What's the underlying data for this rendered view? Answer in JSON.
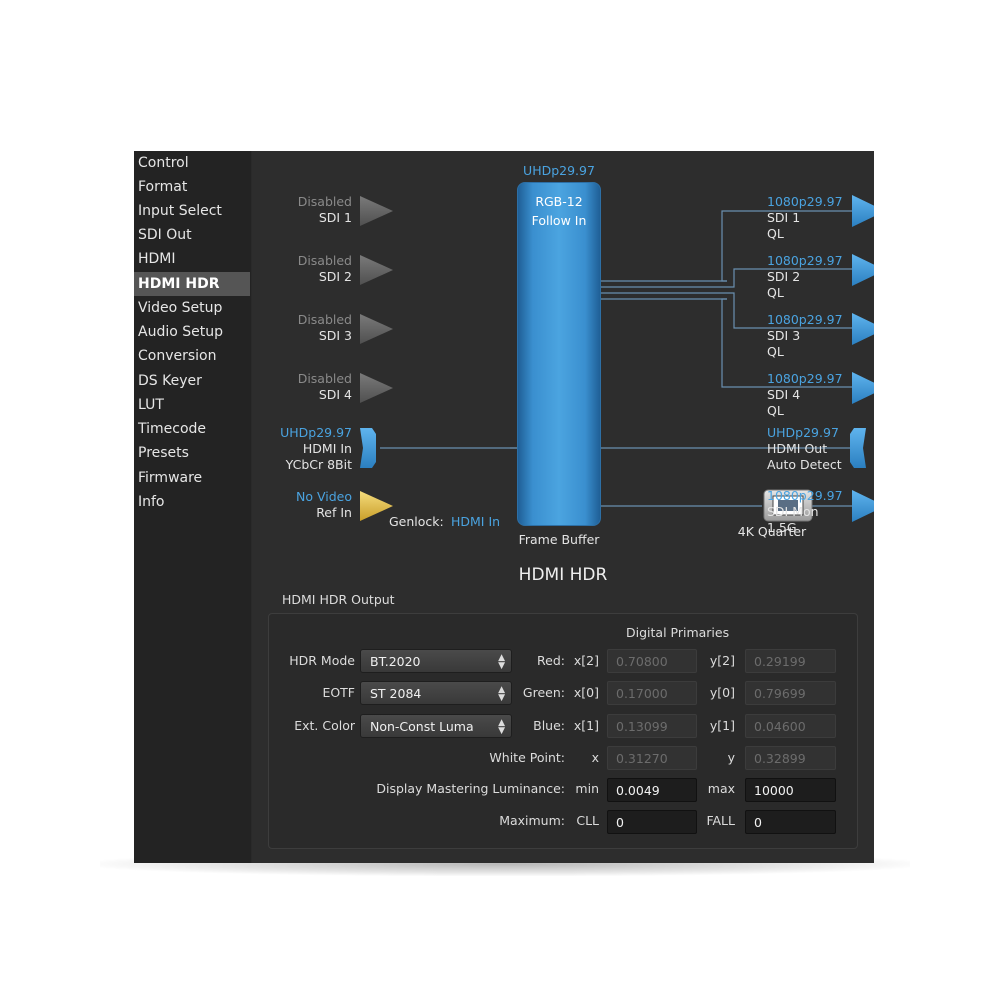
{
  "sidebar": {
    "items": [
      {
        "label": "Control"
      },
      {
        "label": "Format"
      },
      {
        "label": "Input Select"
      },
      {
        "label": "SDI Out"
      },
      {
        "label": "HDMI"
      },
      {
        "label": "HDMI HDR"
      },
      {
        "label": "Video Setup"
      },
      {
        "label": "Audio Setup"
      },
      {
        "label": "Conversion"
      },
      {
        "label": "DS Keyer"
      },
      {
        "label": "LUT"
      },
      {
        "label": "Timecode"
      },
      {
        "label": "Presets"
      },
      {
        "label": "Firmware"
      },
      {
        "label": "Info"
      }
    ],
    "active": "HDMI HDR"
  },
  "diagram": {
    "inputs": [
      {
        "status": "Disabled",
        "name": "SDI 1"
      },
      {
        "status": "Disabled",
        "name": "SDI 2"
      },
      {
        "status": "Disabled",
        "name": "SDI 3"
      },
      {
        "status": "Disabled",
        "name": "SDI 4"
      }
    ],
    "hdmi_in": {
      "format": "UHDp29.97",
      "name": "HDMI In",
      "detail": "YCbCr 8Bit"
    },
    "ref_in": {
      "status": "No Video",
      "name": "Ref In"
    },
    "genlock": {
      "label": "Genlock:",
      "value": "HDMI In"
    },
    "frame_buffer": {
      "format": "UHDp29.97",
      "line1": "RGB-12",
      "line2": "Follow In",
      "label": "Frame Buffer"
    },
    "outputs": [
      {
        "format": "1080p29.97",
        "name": "SDI 1",
        "detail": "QL"
      },
      {
        "format": "1080p29.97",
        "name": "SDI 2",
        "detail": "QL"
      },
      {
        "format": "1080p29.97",
        "name": "SDI 3",
        "detail": "QL"
      },
      {
        "format": "1080p29.97",
        "name": "SDI 4",
        "detail": "QL"
      }
    ],
    "hdmi_out": {
      "format": "UHDp29.97",
      "name": "HDMI Out",
      "detail": "Auto Detect"
    },
    "quarter": {
      "label": "4K Quarter"
    },
    "sdi_mon": {
      "format": "1080p29.97",
      "name": "SDI Mon",
      "detail": "1.5G"
    }
  },
  "page_title": "HDMI HDR",
  "hdr_output": {
    "section_label": "HDMI HDR Output",
    "digital_primaries_label": "Digital Primaries",
    "hdr_mode": {
      "label": "HDR Mode",
      "value": "BT.2020"
    },
    "eotf": {
      "label": "EOTF",
      "value": "ST 2084"
    },
    "ext_color": {
      "label": "Ext. Color",
      "value": "Non-Const Luma"
    },
    "red": {
      "label": "Red:",
      "x_label": "x[2]",
      "x": "0.70800",
      "y_label": "y[2]",
      "y": "0.29199"
    },
    "green": {
      "label": "Green:",
      "x_label": "x[0]",
      "x": "0.17000",
      "y_label": "y[0]",
      "y": "0.79699"
    },
    "blue": {
      "label": "Blue:",
      "x_label": "x[1]",
      "x": "0.13099",
      "y_label": "y[1]",
      "y": "0.04600"
    },
    "white": {
      "label": "White Point:",
      "x_label": "x",
      "x": "0.31270",
      "y_label": "y",
      "y": "0.32899"
    },
    "luminance": {
      "label": "Display Mastering Luminance:",
      "min_label": "min",
      "min": "0.0049",
      "max_label": "max",
      "max": "10000"
    },
    "maximum": {
      "label": "Maximum:",
      "cll_label": "CLL",
      "cll": "0",
      "fall_label": "FALL",
      "fall": "0"
    }
  },
  "colors": {
    "accent_blue": "#4aa3e0",
    "arrow_grey": "#6e6e6e",
    "ref_yellow": "#e8c64a",
    "sidebar_active": "#555555"
  }
}
